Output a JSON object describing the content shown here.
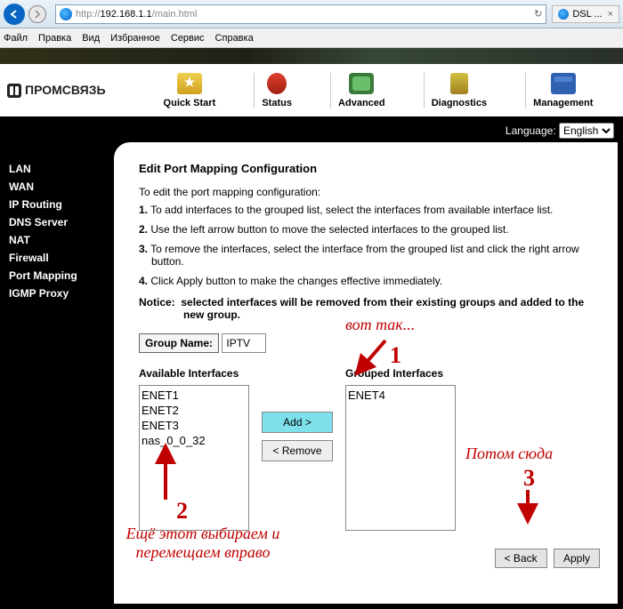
{
  "browser": {
    "url": "http://192.168.1.1/main.html",
    "url_display_prefix": "http://",
    "url_display_host": "192.168.1.1",
    "url_display_path": "/main.html",
    "tab_title": "DSL ..."
  },
  "menubar": {
    "file": "Файл",
    "edit": "Правка",
    "view": "Вид",
    "favorites": "Избранное",
    "tools": "Сервис",
    "help": "Справка"
  },
  "brand": "ПРОМСВЯЗЬ",
  "nav": {
    "quick_start": "Quick Start",
    "status": "Status",
    "advanced": "Advanced",
    "diagnostics": "Diagnostics",
    "management": "Management"
  },
  "language": {
    "label": "Language:",
    "selected": "English"
  },
  "sidebar": {
    "items": [
      "LAN",
      "WAN",
      "IP Routing",
      "DNS Server",
      "NAT",
      "Firewall",
      "Port Mapping",
      "IGMP Proxy"
    ]
  },
  "page": {
    "title": "Edit Port Mapping Configuration",
    "intro": "To edit the port mapping configuration:",
    "steps": [
      "To add interfaces to the grouped list, select the interfaces from available interface list.",
      "Use the left arrow button to move the selected interfaces to the grouped list.",
      "To remove the interfaces, select the interface from the grouped list and click the right arrow button.",
      "Click Apply button to make the changes effective immediately."
    ],
    "notice_label": "Notice:",
    "notice_text": "selected interfaces will be removed from their existing groups and added to the new group.",
    "group_name_label": "Group Name:",
    "group_name_value": "IPTV",
    "available_label": "Available Interfaces",
    "grouped_label": "Grouped Interfaces",
    "available_items": [
      "ENET1",
      "ENET2",
      "ENET3",
      "nas_0_0_32"
    ],
    "grouped_items": [
      "ENET4"
    ],
    "add_btn": "Add >",
    "remove_btn": "< Remove",
    "back_btn": "< Back",
    "apply_btn": "Apply"
  },
  "annotations": {
    "a1_text": "вот так...",
    "a1_num": "1",
    "a2_num": "2",
    "a2_text1": "Ещё этот выбираем и",
    "a2_text2": "перемещаем вправо",
    "a3_text": "Потом сюда",
    "a3_num": "3"
  }
}
